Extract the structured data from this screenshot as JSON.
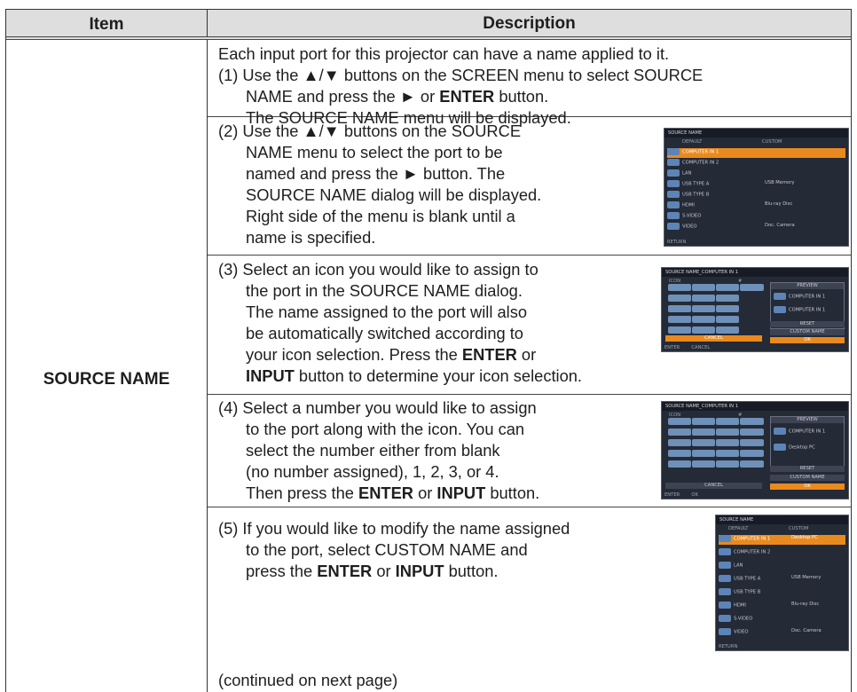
{
  "header": {
    "item": "Item",
    "description": "Description"
  },
  "item_label": "SOURCE NAME",
  "intro": "Each input port for this projector can have a name applied to it.",
  "step1": {
    "line1": "(1) Use the ▲/▼ buttons on the SCREEN menu to select SOURCE",
    "line2_pre": "NAME and press the ► or ",
    "line2_bold": "ENTER",
    "line2_post": " button.",
    "line3": "The SOURCE NAME menu will be displayed."
  },
  "step2": {
    "lines": [
      "(2) Use the ▲/▼ buttons on the SOURCE",
      "NAME menu to select the port to be",
      "named and press the ► button. The",
      "SOURCE NAME dialog will be displayed.",
      "Right side of the menu is blank until a",
      "name is specified."
    ]
  },
  "step3": {
    "lines": [
      "(3) Select an icon you would like to assign to",
      "the port in the SOURCE NAME dialog.",
      "The name assigned to the port will also",
      "be automatically switched according to"
    ],
    "line5_pre": "your icon selection. Press the ",
    "line5_bold": "ENTER",
    "line5_post": " or",
    "line6_bold": "INPUT",
    "line6_post": " button to determine your icon selection."
  },
  "step4": {
    "lines": [
      "(4) Select a number you would like to assign",
      "to the port along with the icon. You can",
      "select the number either from blank",
      "(no number assigned), 1, 2, 3, or 4."
    ],
    "line5_pre": "Then press the ",
    "line5_bold1": "ENTER",
    "line5_mid": " or ",
    "line5_bold2": "INPUT",
    "line5_post": " button."
  },
  "step5": {
    "line1": "(5) If you would like to modify the name assigned",
    "line2": "to the port, select CUSTOM NAME and",
    "line3_pre": "press the ",
    "line3_bold1": "ENTER",
    "line3_mid": " or ",
    "line3_bold2": "INPUT",
    "line3_post": " button."
  },
  "continued": "(continued on next page)",
  "shot_menu": {
    "title": "SOURCE NAME",
    "col_default": "DEFAULT",
    "col_custom": "CUSTOM",
    "rows": [
      "COMPUTER IN 1",
      "COMPUTER IN 2",
      "LAN",
      "USB TYPE A",
      "USB TYPE B",
      "HDMI",
      "S-VIDEO",
      "VIDEO"
    ],
    "custom": [
      "",
      "",
      "",
      "USB Memory",
      "",
      "Blu-ray Disc",
      "",
      "Doc. Camera"
    ],
    "footer": "RETURN"
  },
  "shot_icon": {
    "title": "SOURCE NAME_COMPUTER IN 1",
    "col_icon": "ICON",
    "col_num": "#",
    "preview": "PREVIEW",
    "name_a": "COMPUTER IN 1",
    "name_b": "COMPUTER IN 1",
    "cancel": "CANCEL",
    "reset": "RESET",
    "custom_name": "CUSTOM NAME",
    "ok": "OK",
    "footer_enter": "ENTER",
    "footer_cancel": "CANCEL"
  },
  "shot_number": {
    "title": "SOURCE NAME_COMPUTER IN 1",
    "col_icon": "ICON",
    "col_num": "#",
    "preview": "PREVIEW",
    "name_a": "COMPUTER IN 1",
    "name_b": "Desktop PC",
    "cancel": "CANCEL",
    "reset": "RESET",
    "custom_name": "CUSTOM NAME",
    "ok": "OK",
    "footer_enter": "ENTER",
    "footer_ok": "OK"
  },
  "shot_menu2": {
    "title": "SOURCE NAME",
    "col_default": "DEFAULT",
    "col_custom": "CUSTOM",
    "rows": [
      "COMPUTER IN 1",
      "COMPUTER IN 2",
      "LAN",
      "USB TYPE A",
      "USB TYPE B",
      "HDMI",
      "S-VIDEO",
      "VIDEO"
    ],
    "custom": [
      "Desktop PC",
      "",
      "",
      "USB Memory",
      "",
      "Blu-ray Disc",
      "",
      "Doc. Camera"
    ],
    "footer": "RETURN"
  }
}
